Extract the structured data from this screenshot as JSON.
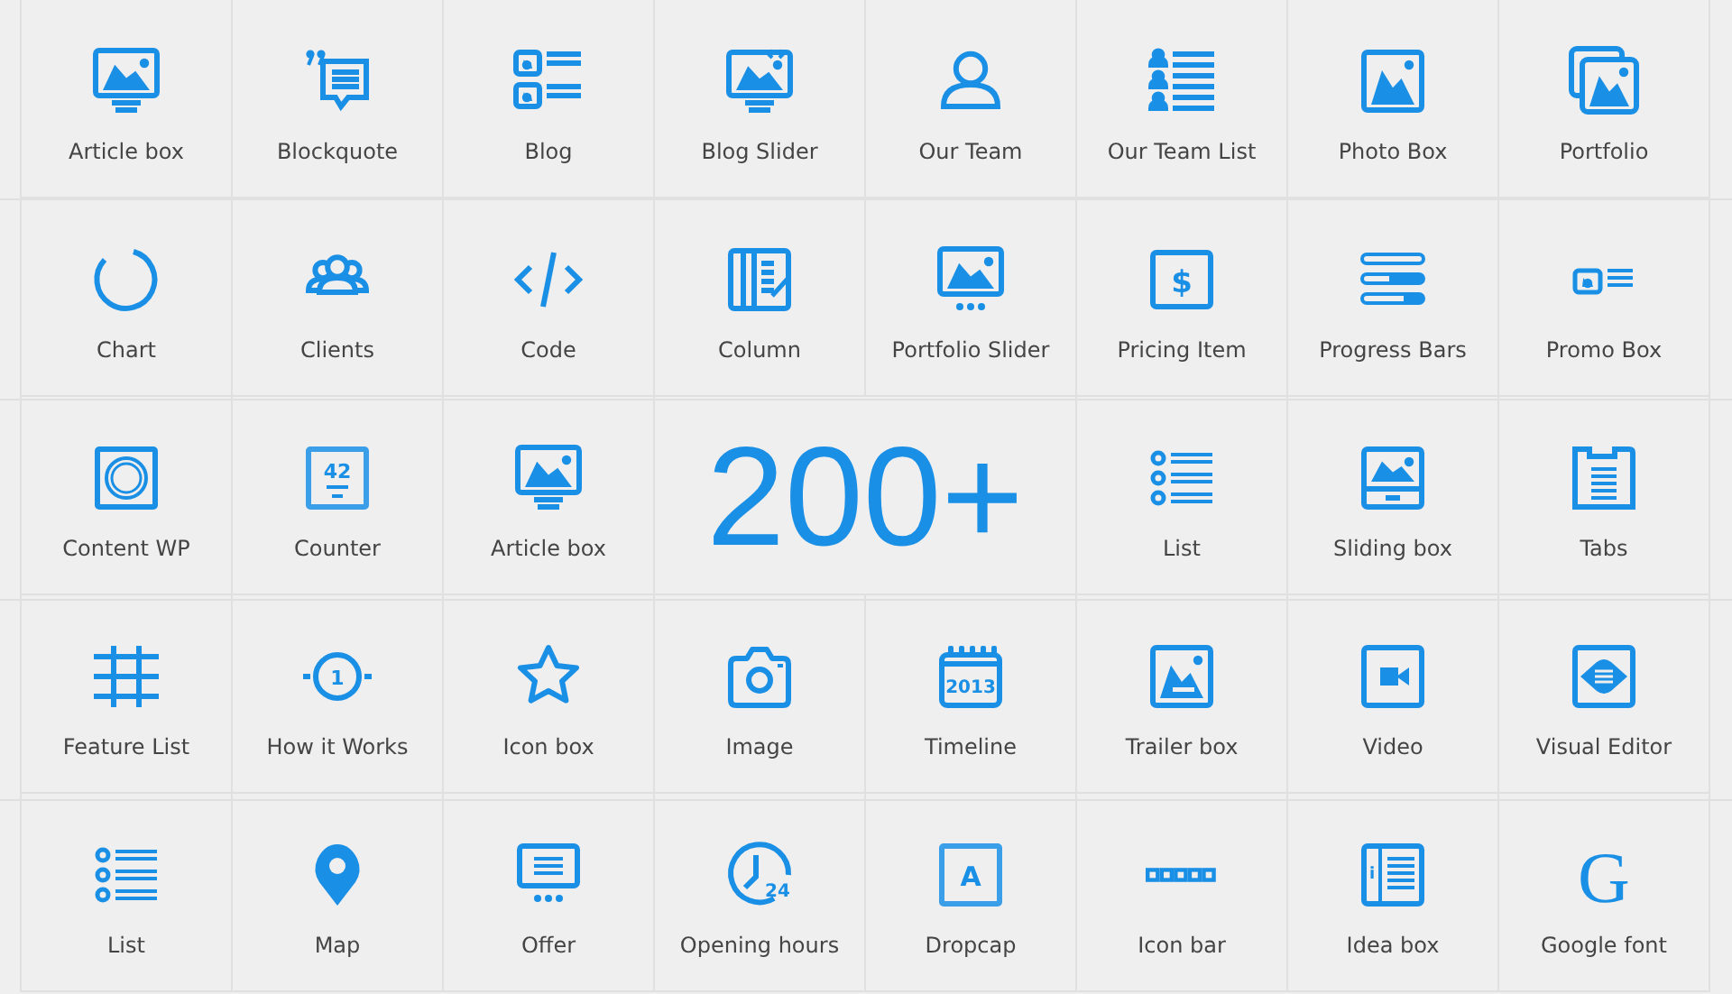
{
  "tiles": [
    {
      "kind": "tile",
      "label": "Article box"
    },
    {
      "kind": "tile",
      "label": "Blockquote"
    },
    {
      "kind": "tile",
      "label": "Blog"
    },
    {
      "kind": "tile",
      "label": "Blog Slider"
    },
    {
      "kind": "tile",
      "label": "Our Team"
    },
    {
      "kind": "tile",
      "label": "Our Team List"
    },
    {
      "kind": "tile",
      "label": "Photo Box"
    },
    {
      "kind": "tile",
      "label": "Portfolio"
    },
    {
      "kind": "tile",
      "label": "Chart"
    },
    {
      "kind": "tile",
      "label": "Clients"
    },
    {
      "kind": "tile",
      "label": "Code"
    },
    {
      "kind": "tile",
      "label": "Column"
    },
    {
      "kind": "tile",
      "label": "Portfolio Slider"
    },
    {
      "kind": "tile",
      "label": "Pricing Item",
      "icon_text": "$"
    },
    {
      "kind": "tile",
      "label": "Progress Bars"
    },
    {
      "kind": "tile",
      "label": "Promo Box"
    },
    {
      "kind": "tile",
      "label": "Content WP"
    },
    {
      "kind": "tile",
      "label": "Counter",
      "icon_text": "42"
    },
    {
      "kind": "tile",
      "label": "Article box"
    },
    {
      "kind": "headline",
      "text": "200+"
    },
    {
      "kind": "tile",
      "label": "List"
    },
    {
      "kind": "tile",
      "label": "Sliding box"
    },
    {
      "kind": "tile",
      "label": "Tabs"
    },
    {
      "kind": "tile",
      "label": "Feature List"
    },
    {
      "kind": "tile",
      "label": "How it Works",
      "icon_text": "1"
    },
    {
      "kind": "tile",
      "label": "Icon box"
    },
    {
      "kind": "tile",
      "label": "Image"
    },
    {
      "kind": "tile",
      "label": "Timeline",
      "icon_text": "2013"
    },
    {
      "kind": "tile",
      "label": "Trailer box"
    },
    {
      "kind": "tile",
      "label": "Video"
    },
    {
      "kind": "tile",
      "label": "Visual Editor"
    },
    {
      "kind": "tile",
      "label": "List"
    },
    {
      "kind": "tile",
      "label": "Map"
    },
    {
      "kind": "tile",
      "label": "Offer"
    },
    {
      "kind": "tile",
      "label": "Opening hours",
      "icon_text": "24"
    },
    {
      "kind": "tile",
      "label": "Dropcap",
      "icon_text": "A"
    },
    {
      "kind": "tile",
      "label": "Icon bar"
    },
    {
      "kind": "tile",
      "label": "Idea box",
      "icon_text": "i"
    },
    {
      "kind": "tile",
      "label": "Google font",
      "icon_text": "G"
    }
  ]
}
